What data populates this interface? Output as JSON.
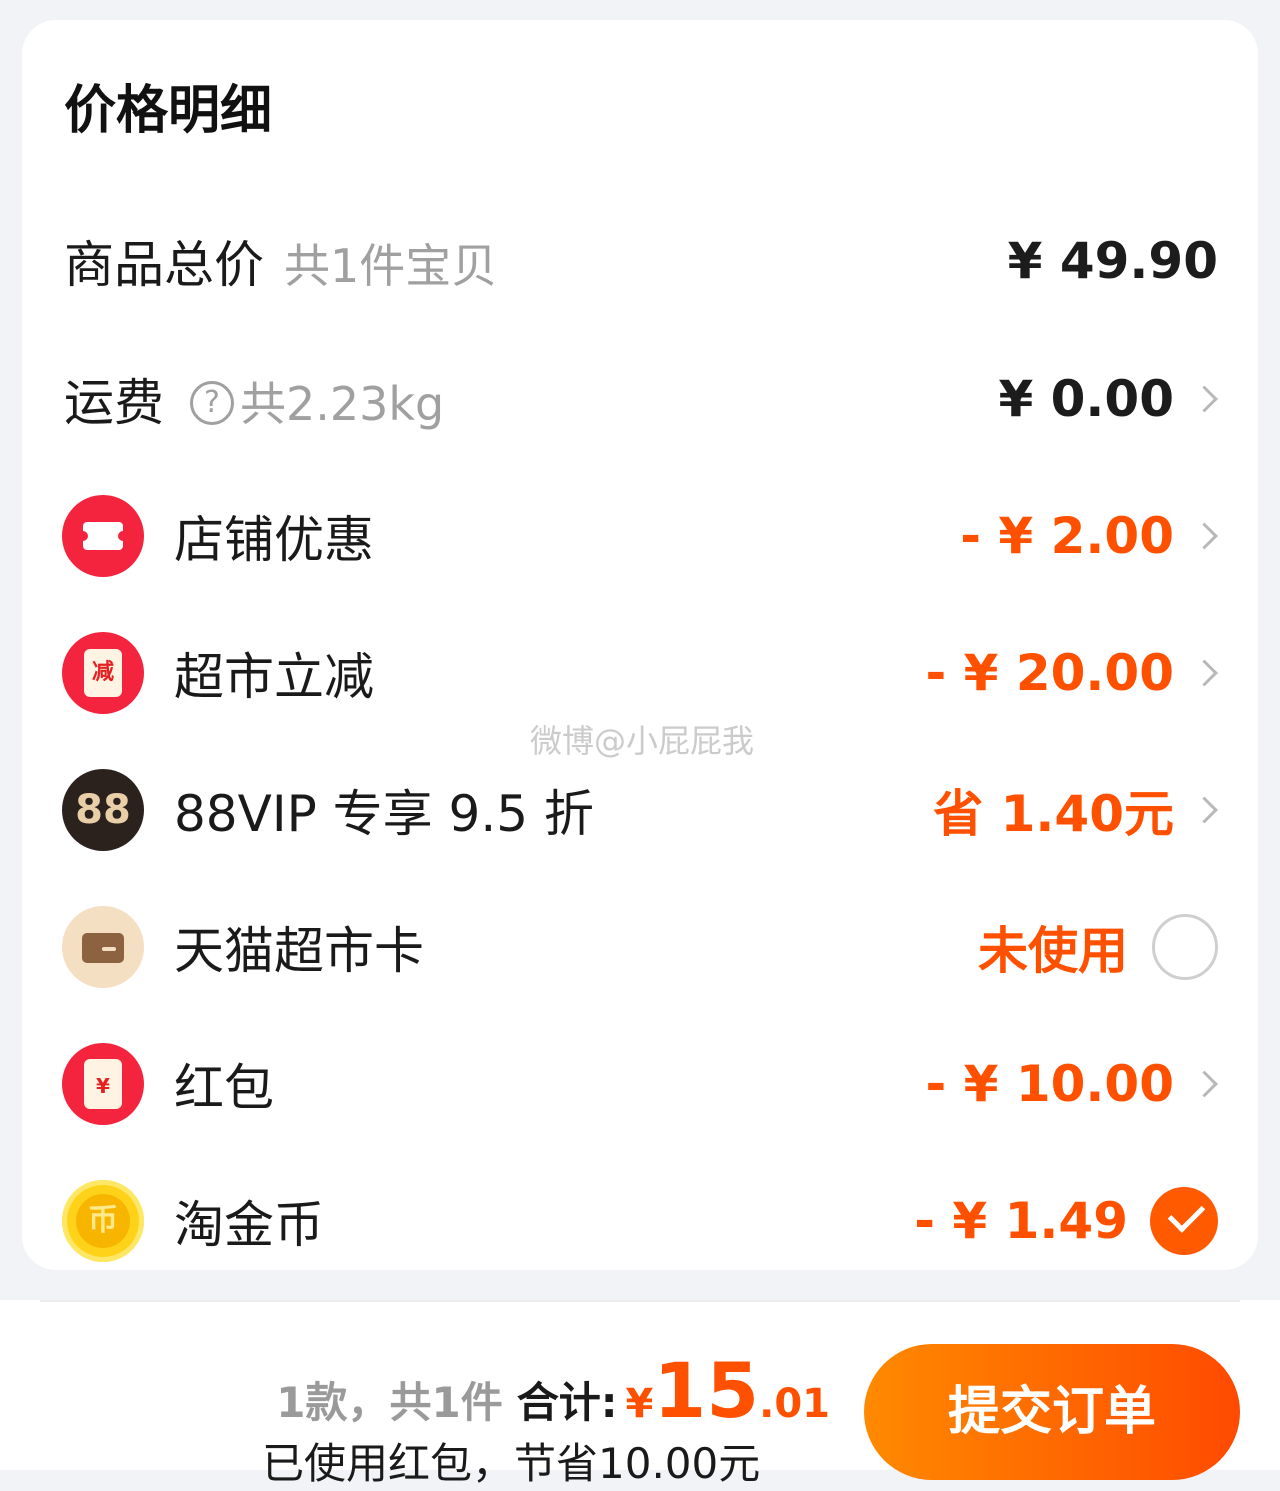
{
  "card": {
    "title": "价格明细"
  },
  "rows": {
    "goods": {
      "label": "商品总价",
      "sub": "共1件宝贝",
      "value": "¥ 49.90"
    },
    "shipping": {
      "label": "运费",
      "help_glyph": "?",
      "sub": "共2.23kg",
      "value": "¥ 0.00"
    },
    "shop_discount": {
      "icon": "ticket-icon",
      "label": "店铺优惠",
      "value": "- ¥ 2.00"
    },
    "supermarket_cut": {
      "icon": "reduce-badge-icon",
      "icon_text": "减",
      "label": "超市立减",
      "value": "- ¥ 20.00"
    },
    "vip": {
      "icon": "vip88-icon",
      "icon_text": "88",
      "label": "88VIP 专享 9.5 折",
      "value": "省 1.40元"
    },
    "tmall_card": {
      "icon": "card-icon",
      "label": "天猫超市卡",
      "value": "未使用",
      "selected": false
    },
    "red_packet": {
      "icon": "red-packet-icon",
      "icon_text": "¥",
      "label": "红包",
      "value": "- ¥ 10.00"
    },
    "taojinbi": {
      "icon": "coin-icon",
      "icon_text": "币",
      "label": "淘金币",
      "value": "- ¥ 1.49",
      "selected": true
    }
  },
  "watermark": "微博@小屁屁我",
  "footer": {
    "count_text": "1款，共1件",
    "total_label": "合计:",
    "currency": "¥",
    "total_int": "15",
    "total_dec": ".01",
    "note": "已使用红包，节省10.00元",
    "submit_label": "提交订单"
  },
  "colors": {
    "accent": "#ff5000",
    "icon_red": "#f4233e",
    "background": "#f2f3f7"
  }
}
